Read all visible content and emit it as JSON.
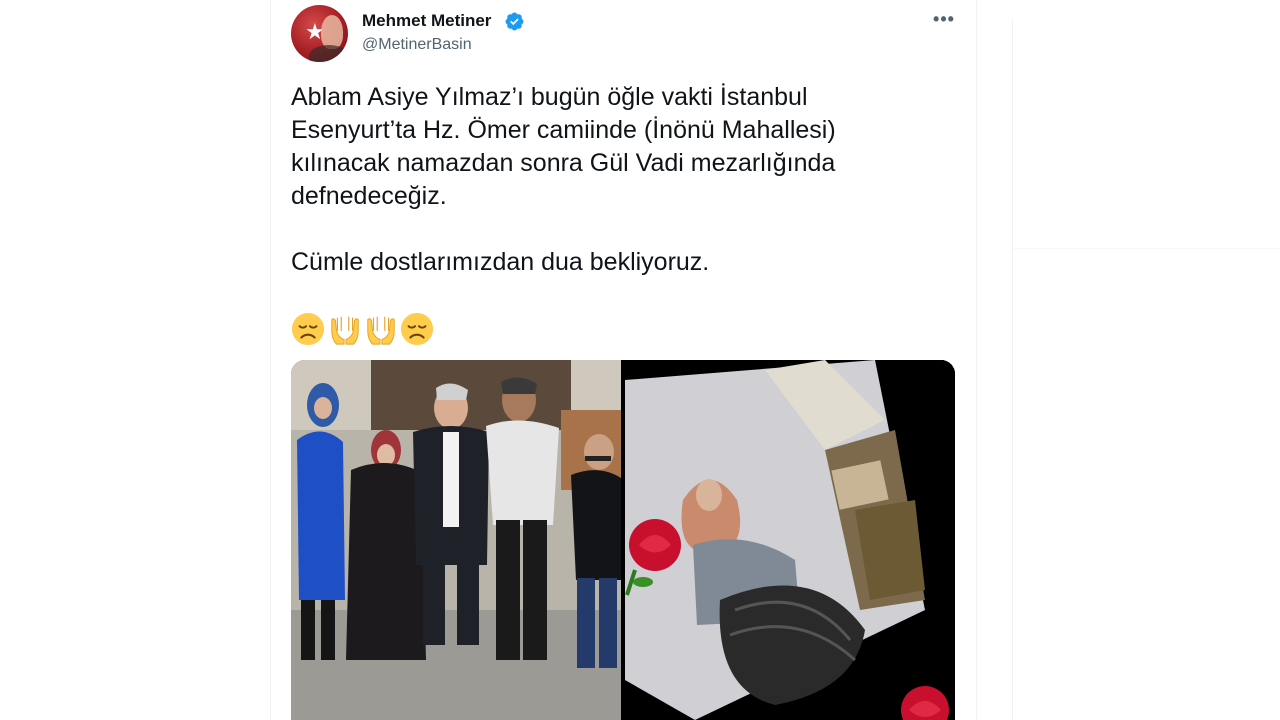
{
  "tweet": {
    "author": {
      "display_name": "Mehmet Metiner",
      "handle": "@MetinerBasin",
      "verified": true
    },
    "text_paragraphs": [
      "Ablam Asiye Yılmaz’ı bugün öğle vakti İstanbul\nEsenyurt’ta Hz. Ömer camiinde (İnönü Mahallesi)\nkılınacak namazdan sonra Gül Vadi mezarlığında\ndefnedeceğiz.",
      "Cümle dostlarımızdan dua bekliyoruz."
    ],
    "more_label": "•••",
    "emojis": [
      "disappointed-face",
      "palms-up-together",
      "palms-up-together",
      "disappointed-face"
    ],
    "media": [
      {
        "kind": "photo",
        "subject": "group-photo-five-people"
      },
      {
        "kind": "photo",
        "subject": "woman-seated-with-rose-frame"
      }
    ]
  },
  "colors": {
    "text_primary": "#0f1419",
    "text_secondary": "#536471",
    "verified_blue": "#1d9bf0",
    "border": "#eff3f4",
    "emoji_yellow": "#ffcc4d"
  }
}
